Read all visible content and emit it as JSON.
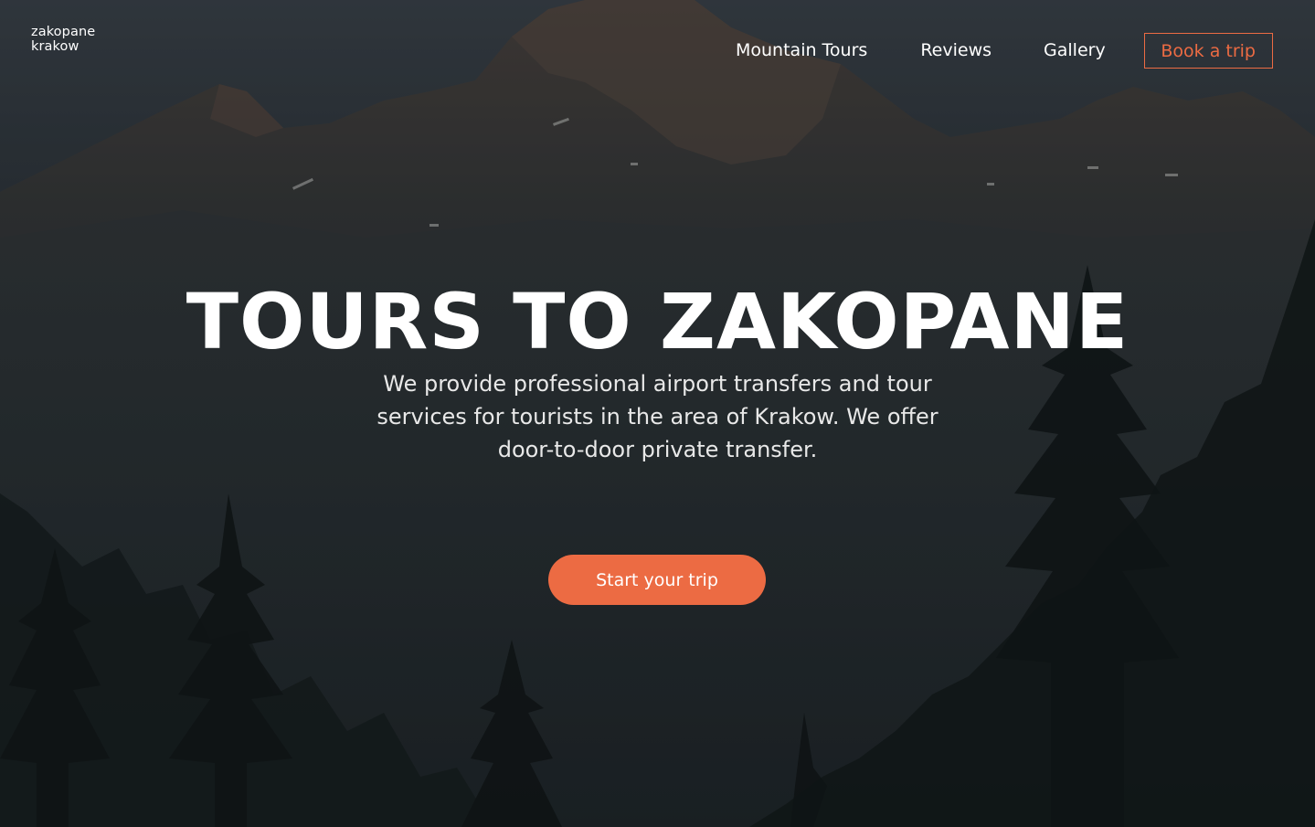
{
  "logo": {
    "line1": "zakopane",
    "line2": "krakow"
  },
  "nav": {
    "items": [
      {
        "label": "Mountain Tours"
      },
      {
        "label": "Reviews"
      },
      {
        "label": "Gallery"
      }
    ],
    "cta_label": "Book a trip"
  },
  "hero": {
    "title": "TOURS TO ZAKOPANE",
    "subtitle": "We  provide professional airport transfers and tour services for tourists in the area of Krakow. We offer door-to-door private transfer.",
    "button_label": "Start your trip"
  },
  "colors": {
    "accent": "#ec6b43",
    "text": "#ffffff"
  }
}
